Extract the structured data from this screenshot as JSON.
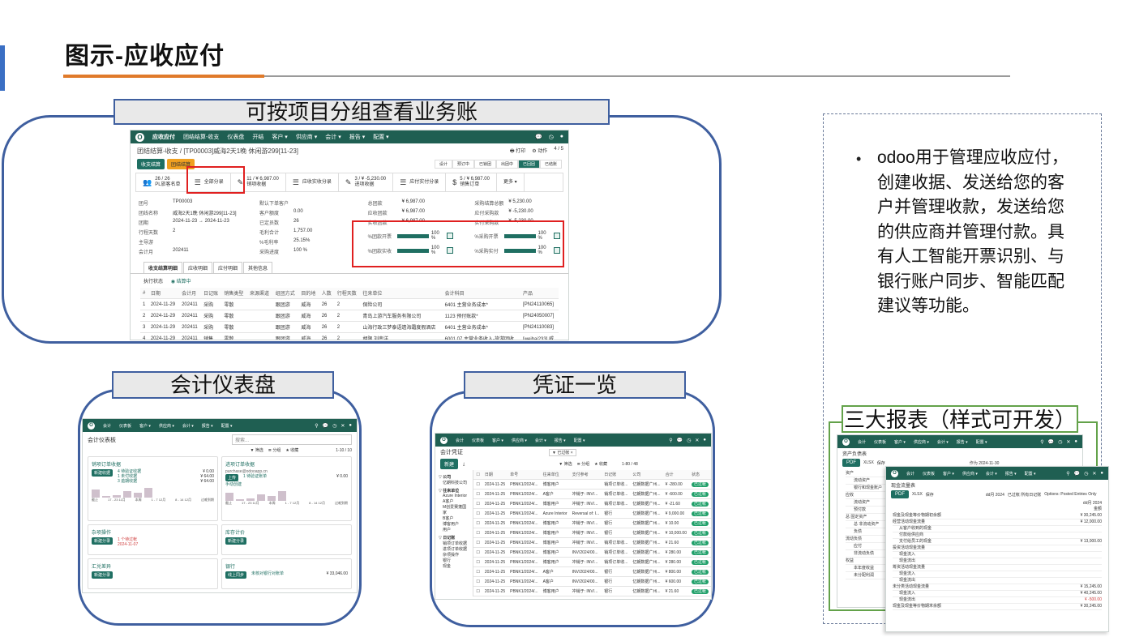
{
  "slide": {
    "title": "图示-应收应付"
  },
  "panels": {
    "project": "可按项目分组查看业务账",
    "dashboard": "会计仪表盘",
    "vouchers": "凭证一览",
    "reports": "三大报表（样式可开发）"
  },
  "bullet": {
    "text": "odoo用于管理应收应付，创建收据、发送给您的客户并管理收款，发送给您的供应商并管理付款。具有人工智能开票识别、与银行账户同步、智能匹配建议等功能。"
  },
  "project_screen": {
    "menu": [
      "应收应付",
      "团结结算-收支",
      "仪表盘",
      "开结",
      "客户 ▾",
      "供应商 ▾",
      "会计 ▾",
      "报告 ▾",
      "配置 ▾"
    ],
    "breadcrumb": "团结结算-收支 / [TP00003]威海2天1晚 休闲游299[11-23]",
    "pager": "4 / 5",
    "print_label": "打印",
    "action_label": "动作",
    "btn_settle": "收支结算",
    "btn_close": "团结结算",
    "stages": [
      "设计",
      "预订中",
      "已锁团",
      "出团中",
      "已回团",
      "已结账"
    ],
    "stats": [
      {
        "icon": "users-icon",
        "label": "26 / 26\nPL旅客名单"
      },
      {
        "icon": "list-icon",
        "label": "全部分录"
      },
      {
        "icon": "edit-icon",
        "label": "11 / ¥ 6,987.00\n销项收据"
      },
      {
        "icon": "list-icon",
        "label": "应收实收分录"
      },
      {
        "icon": "edit-icon",
        "label": "3 / ¥ -5,230.00\n进项收据"
      },
      {
        "icon": "list-icon",
        "label": "应付实付分录"
      },
      {
        "icon": "dollar-icon",
        "label": "5 / ¥ 6,987.00\n销售订单"
      },
      {
        "icon": "",
        "label": "更多 ▾"
      }
    ],
    "fields_left": [
      [
        "团号",
        "TP00003"
      ],
      [
        "团线名称",
        "威海2天1晚 休闲游299[11-23]"
      ],
      [
        "团期",
        "2024-11-23 → 2024-11-23"
      ],
      [
        "行程天数",
        "2"
      ],
      [
        "主导游",
        ""
      ],
      [
        "会计月",
        "202411"
      ]
    ],
    "fields_mid": [
      [
        "默认下单客户",
        ""
      ],
      [
        "客户额度",
        "0.00"
      ],
      [
        "已定员数",
        "26"
      ],
      [
        "毛利合计",
        "1,757.00"
      ],
      [
        "%毛利率",
        "25.15%"
      ],
      [
        "采购进度",
        "100 %"
      ]
    ],
    "fields_right": [
      [
        "总团款",
        "¥ 6,987.00"
      ],
      [
        "应收团款",
        "¥ 6,987.00"
      ],
      [
        "实收团款",
        "¥ 6,987.00"
      ]
    ],
    "fields_far": [
      [
        "采购结算总额",
        "¥ 5,230.00"
      ],
      [
        "应付采购款",
        "¥ -5,230.00"
      ],
      [
        "实付采购款",
        "¥ -5,230.00"
      ]
    ],
    "progress": [
      {
        "label": "%团款开票",
        "value": "100 %",
        "pct": 100
      },
      {
        "label": "%采购开票",
        "value": "100 %",
        "pct": 100
      },
      {
        "label": "%团款实收",
        "value": "100 %",
        "pct": 100
      },
      {
        "label": "%采购实付",
        "value": "100 %",
        "pct": 100
      }
    ],
    "tabs": [
      "收支结算明细",
      "应收明细",
      "应付明细",
      "其他信息"
    ],
    "exec_status_label": "执行状态",
    "exec_status_value": "结算中",
    "table_headers": [
      "#",
      "日期",
      "会计月",
      "日记账",
      "销售类型",
      "来源渠道",
      "组团方式",
      "目的地",
      "人数",
      "行程天数",
      "往来单位",
      "会计科目",
      "产品"
    ],
    "table_rows": [
      [
        "1",
        "2024-11-29",
        "202411",
        "采购",
        "零散",
        "",
        "跟团游",
        "威海",
        "26",
        "2",
        "保险公司",
        "6401 主营业务成本*",
        "[PN24110065]"
      ],
      [
        "2",
        "2024-11-29",
        "202411",
        "采购",
        "零散",
        "",
        "跟团游",
        "威海",
        "26",
        "2",
        "青岛上游汽车服务有限公司",
        "1123 预付账款*",
        "[PN24050007]"
      ],
      [
        "3",
        "2024-11-29",
        "202411",
        "采购",
        "零散",
        "",
        "跟团游",
        "威海",
        "26",
        "2",
        "山海行政三梦泰语遗海霜度假酒店",
        "6401 主营业务成本*",
        "[PN24110083]"
      ],
      [
        "4",
        "2024-11-29",
        "202411",
        "销售",
        "零散",
        "",
        "跟团游",
        "威海",
        "26",
        "2",
        "胡限 刘南洋",
        "6001.07 主营业务收入-旅游团收",
        "[weihai233] 威"
      ]
    ]
  },
  "dashboard_screen": {
    "menu": [
      "会计",
      "仪表板",
      "客户 ▾",
      "供应商 ▾",
      "会计 ▾",
      "报告 ▾",
      "配置 ▾"
    ],
    "title": "会计仪表板",
    "search_placeholder": "搜索...",
    "filters": [
      "▼ 筛选",
      "≣ 分组",
      "★ 收藏"
    ],
    "pager": "1-10 / 10",
    "cards": [
      {
        "title": "销项订单收据",
        "button": "新建收据",
        "lines": [
          "4 待验证收据",
          "1 未付收据",
          "3 逾期收据"
        ],
        "amounts": [
          "¥ 0.00",
          "¥ 64.00",
          "¥ 64.00"
        ],
        "axis": [
          "截止",
          "17 - 23 11月",
          "本周",
          "1 - 7 12月",
          "8 - 14 12月",
          "过难到期"
        ]
      },
      {
        "title": "进项订单收据",
        "subtitle": "purchase@odooapp.cn",
        "button": "上传",
        "link": "手动创建",
        "lines": [
          "1 待验证账单"
        ],
        "amounts": [
          "¥ 0.00"
        ],
        "axis": [
          "截止",
          "17 - 23 11月",
          "本周",
          "1 - 7 12月",
          "8 - 14 12月",
          "过难到期"
        ]
      },
      {
        "title": "杂项操作",
        "button": "新建分录",
        "lines": [
          "1 个待过帐",
          "2024-11-07"
        ]
      },
      {
        "title": "库存计价",
        "button": "新建分录"
      },
      {
        "title": "汇兑差异",
        "button": "新建分录"
      },
      {
        "title": "银行",
        "button": "线上同步",
        "lines": [
          "未核对银行对账单"
        ],
        "amounts": [
          "¥ 33,046.00"
        ]
      }
    ]
  },
  "vouchers_screen": {
    "menu": [
      "会计",
      "仪表板",
      "客户 ▾",
      "供应商 ▾",
      "会计 ▾",
      "报告 ▾",
      "配置 ▾"
    ],
    "title": "会计凭证",
    "search_tag": "已过帐",
    "new_button": "新建",
    "filters": [
      "▼ 筛选",
      "≣ 分组",
      "★ 收藏"
    ],
    "pager": "1-80 / 48",
    "sidebar_groups": [
      {
        "title": "公司",
        "items": [
          "亿朗科技公司"
        ]
      },
      {
        "title": "往来单位",
        "items": [
          "Azure Interior",
          "A客户",
          "M创爱赛蓬国家",
          "B客户",
          "博客用户",
          "用户"
        ]
      },
      {
        "title": "日记账",
        "items": [
          "销项订单收据",
          "进项订单收据",
          "杂项操作",
          "银行",
          "现金"
        ]
      }
    ],
    "headers": [
      "日期",
      "单号",
      "往来单位",
      "支付参考",
      "日记账",
      "公司",
      "合计",
      "状态"
    ],
    "rows": [
      [
        "2024-11-25",
        "PBNK1/2024/...",
        "博客用户",
        "",
        "销项订单收...",
        "亿朗数据广州...",
        "¥ -280.00",
        "已过帐"
      ],
      [
        "2024-11-25",
        "PBNK1/2024/...",
        "A客户",
        "冲销于: INV/...",
        "销项订单收...",
        "亿朗数据广州...",
        "¥ -600.00",
        "已过帐"
      ],
      [
        "2024-11-25",
        "PBNK1/2024/...",
        "博客用户",
        "冲销于: INV/...",
        "销项订单收...",
        "亿朗数据广州...",
        "¥ -21.60",
        "已过帐"
      ],
      [
        "2024-11-25",
        "PBNK1/2024/...",
        "Azure Interior",
        "Reversal of: I...",
        "银行",
        "亿朗数据广州...",
        "¥ 9,000.00",
        "已过帐"
      ],
      [
        "2024-11-25",
        "PBNK1/2024/...",
        "博客用户",
        "冲销于: INV/...",
        "银行",
        "亿朗数据广州...",
        "¥ 10.00",
        "已过帐"
      ],
      [
        "2024-11-25",
        "PBNK1/2024/...",
        "博客用户",
        "冲销于: INV/...",
        "银行",
        "亿朗数据广州...",
        "¥ 10,000.00",
        "已过帐"
      ],
      [
        "2024-11-25",
        "PBNK1/2024/...",
        "博客用户",
        "冲销于: INV/...",
        "销项订单收...",
        "亿朗数据广州...",
        "¥ 21.60",
        "已过帐"
      ],
      [
        "2024-11-25",
        "PBNK1/2024/...",
        "博客用户",
        "INV/2024/00...",
        "销项订单收...",
        "亿朗数据广州...",
        "¥ 280.00",
        "已过帐"
      ],
      [
        "2024-11-25",
        "PBNK1/2024/...",
        "博客用户",
        "冲销于: INV/...",
        "销项订单收...",
        "亿朗数据广州...",
        "¥ 280.00",
        "已过帐"
      ],
      [
        "2024-11-25",
        "PBNK1/2024/...",
        "A客户",
        "INV/2024/00...",
        "银行",
        "亿朗数据广州...",
        "¥ 800.00",
        "已过帐"
      ],
      [
        "2024-11-25",
        "PBNK1/2024/...",
        "A客户",
        "INV/2024/00...",
        "银行",
        "亿朗数据广州...",
        "¥ 600.00",
        "已过帐"
      ],
      [
        "2024-11-25",
        "PBNK1/2024/...",
        "博客用户",
        "冲销于: INV/...",
        "银行",
        "亿朗数据广州...",
        "¥ 21.60",
        "已过帐"
      ]
    ]
  },
  "reports_screen": {
    "menu": [
      "会计",
      "仪表板",
      "客户 ▾",
      "供应商 ▾",
      "会计 ▾",
      "报告 ▾",
      "配置 ▾"
    ],
    "back_title": "资产负债表",
    "back_tabs": [
      "PDF",
      "XLSX",
      "保存"
    ],
    "back_period": "作为 2024-11-30",
    "back_rows": [
      "资产",
      "流动资产",
      "银行和现金账户",
      "应收",
      "流动资产",
      "预付款",
      "总 固定资产",
      "总 非流动资产",
      "负债",
      "流动负债",
      "应付",
      "非流动负债",
      "权益",
      "本年度收益",
      "未分配利润"
    ],
    "front_title": "现金流量表",
    "front_tabs": [
      "PDF",
      "XLSX",
      "保存"
    ],
    "front_period": "dd月 2024",
    "front_options": [
      "已过帐 所有日记账",
      "Options: Posted Entries Only"
    ],
    "front_rows": [
      [
        "现金及现金等价物期初余额",
        "¥ 30,245.00"
      ],
      [
        "经营活动现金流量",
        "¥ 12,000.00"
      ],
      [
        "从客户收到的现金",
        ""
      ],
      [
        "付款给供应商",
        ""
      ],
      [
        "支付给员工的现金",
        "¥ 13,000.00"
      ],
      [
        "投资活动现金流量",
        ""
      ],
      [
        "现金流入",
        ""
      ],
      [
        "现金流出",
        ""
      ],
      [
        "筹资活动现金流量",
        ""
      ],
      [
        "现金流入",
        ""
      ],
      [
        "现金流出",
        ""
      ],
      [
        "未分类活动现金流量",
        "¥ 15,245.00"
      ],
      [
        "现金流入",
        "¥ 40,245.00"
      ],
      [
        "现金流出",
        "¥ -500.00"
      ],
      [
        "现金及现金等价物期末余额",
        "¥ 30,245.00"
      ]
    ],
    "front_col_head": "dd月 2024\n金额"
  },
  "colors": {
    "odoo_green": "#1f5f52",
    "frame_blue": "#3f5f9f",
    "accent_orange": "#e07a2a",
    "highlight_red": "#e02020",
    "report_green": "#63a24a"
  }
}
